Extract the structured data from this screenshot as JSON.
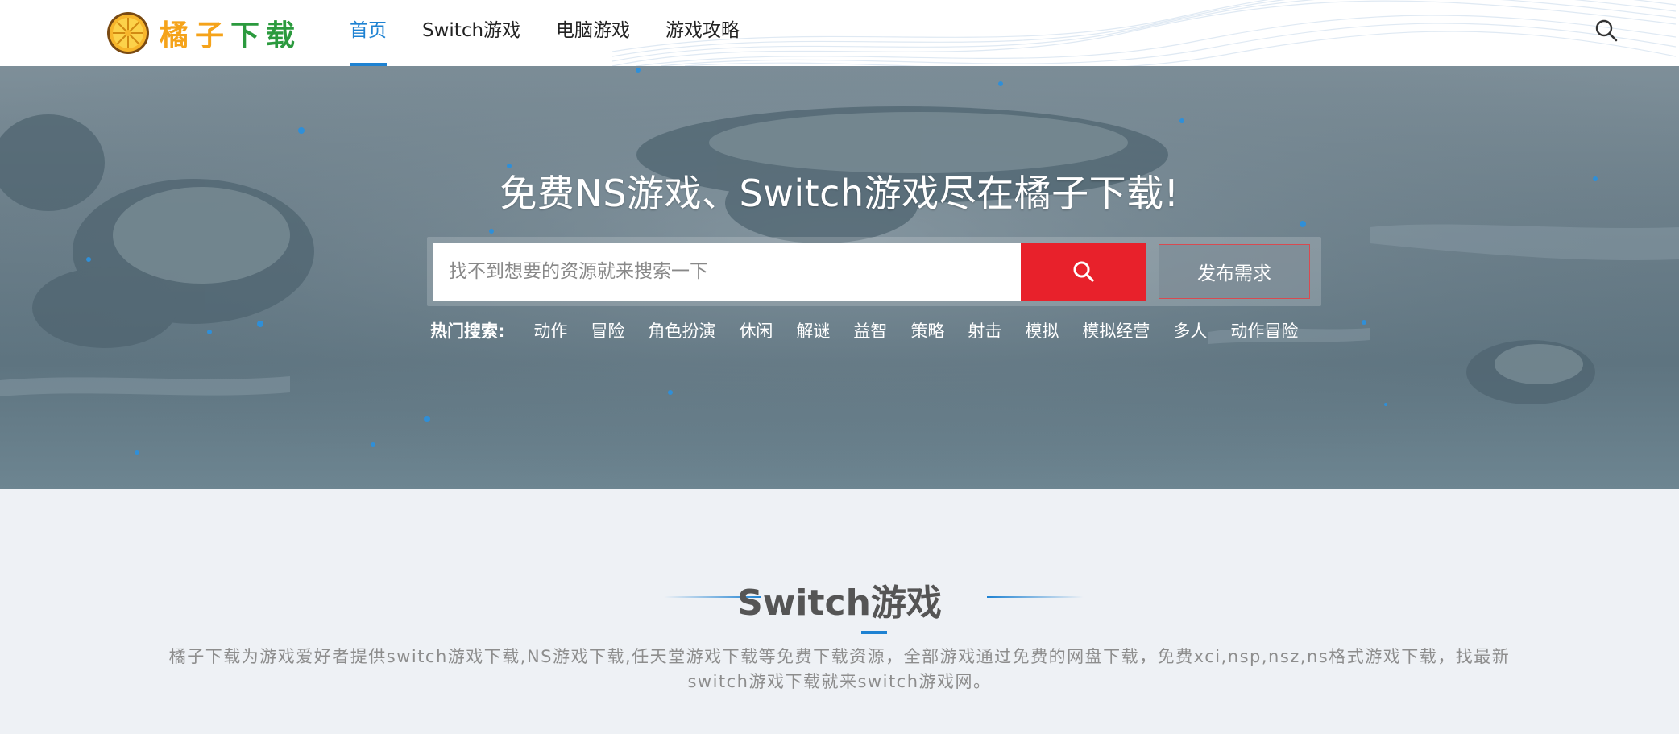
{
  "header": {
    "logo_text": [
      "橘",
      "子",
      "下",
      "载"
    ],
    "nav": [
      {
        "label": "首页",
        "active": true
      },
      {
        "label": "Switch游戏",
        "active": false
      },
      {
        "label": "电脑游戏",
        "active": false
      },
      {
        "label": "游戏攻略",
        "active": false
      }
    ],
    "search_icon": "search-icon"
  },
  "hero": {
    "title": "免费NS游戏、Switch游戏尽在橘子下载!",
    "search_placeholder": "找不到想要的资源就来搜索一下",
    "search_button_icon": "search-icon",
    "publish_label": "发布需求",
    "hot_label": "热门搜索:",
    "hot_tags": [
      "动作",
      "冒险",
      "角色扮演",
      "休闲",
      "解谜",
      "益智",
      "策略",
      "射击",
      "模拟",
      "模拟经营",
      "多人",
      "动作冒险"
    ]
  },
  "section": {
    "title": "Switch游戏",
    "description": "橘子下载为游戏爱好者提供switch游戏下载,NS游戏下载,任天堂游戏下载等免费下载资源，全部游戏通过免费的网盘下载，免费xci,nsp,nsz,ns格式游戏下载，找最新switch游戏下载就来switch游戏网。"
  },
  "colors": {
    "accent_blue": "#1e82d2",
    "search_red": "#e8212b",
    "logo_orange": "#f5a31a",
    "logo_green": "#2b9a3e"
  }
}
